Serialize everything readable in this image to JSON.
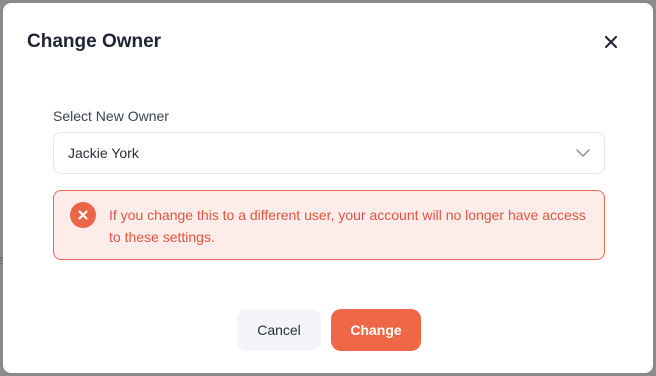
{
  "dialog": {
    "title": "Change Owner"
  },
  "form": {
    "owner_label": "Select New Owner",
    "owner_value": "Jackie York"
  },
  "alert": {
    "message": "If you change this to a different user, your account will no longer have access to these settings.",
    "color": "#ed6548"
  },
  "actions": {
    "cancel_label": "Cancel",
    "change_label": "Change",
    "accent_color": "#ef6746"
  },
  "icons": {
    "close": "close-icon",
    "dropdown": "chevron-down-icon",
    "error": "error-x-icon"
  }
}
